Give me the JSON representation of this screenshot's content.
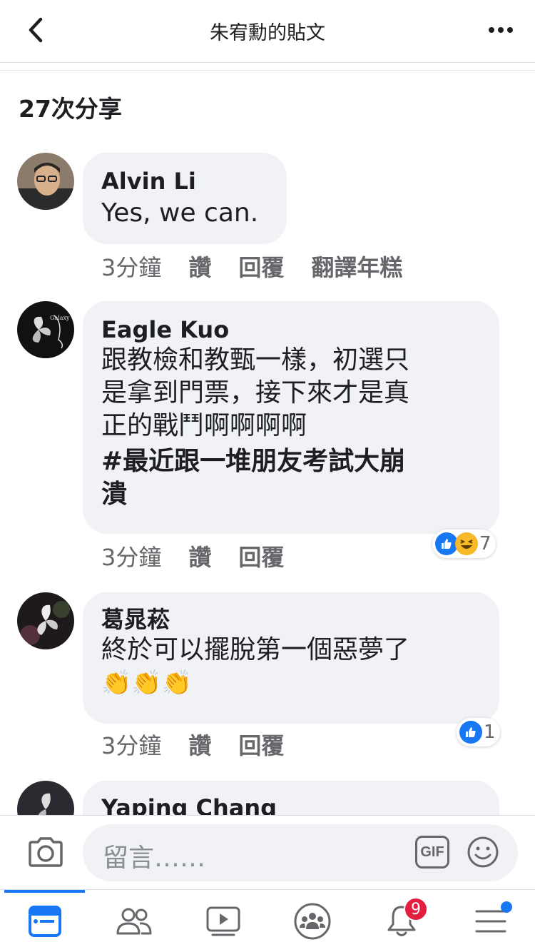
{
  "header": {
    "title": "朱宥勳的貼文"
  },
  "shares": "27次分享",
  "comments": [
    {
      "name": "Alvin Li",
      "text": "Yes, we can.",
      "time": "3分鐘",
      "like": "讚",
      "reply": "回覆",
      "translate": "翻譯年糕"
    },
    {
      "name": "Eagle Kuo",
      "lines": [
        "跟教檢和教甄一樣，初選只",
        "是拿到門票，接下來才是真",
        "正的戰鬥啊啊啊啊"
      ],
      "hashtag_lines": [
        "#最近跟一堆朋友考試大崩",
        "潰"
      ],
      "time": "3分鐘",
      "like": "讚",
      "reply": "回覆",
      "reaction_count": "7"
    },
    {
      "name": "葛晁菘",
      "text": "終於可以擺脫第一個惡夢了",
      "emoji": "👏👏👏",
      "time": "3分鐘",
      "like": "讚",
      "reply": "回覆",
      "reaction_count": "1"
    },
    {
      "name": "Yaping Chang"
    }
  ],
  "composer": {
    "placeholder": "留言……",
    "gif_label": "GIF"
  },
  "tabbar": {
    "notification_badge": "9"
  },
  "colors": {
    "accent": "#1877f2",
    "bubble": "#f0f2f5",
    "badge": "#e41e3f"
  }
}
